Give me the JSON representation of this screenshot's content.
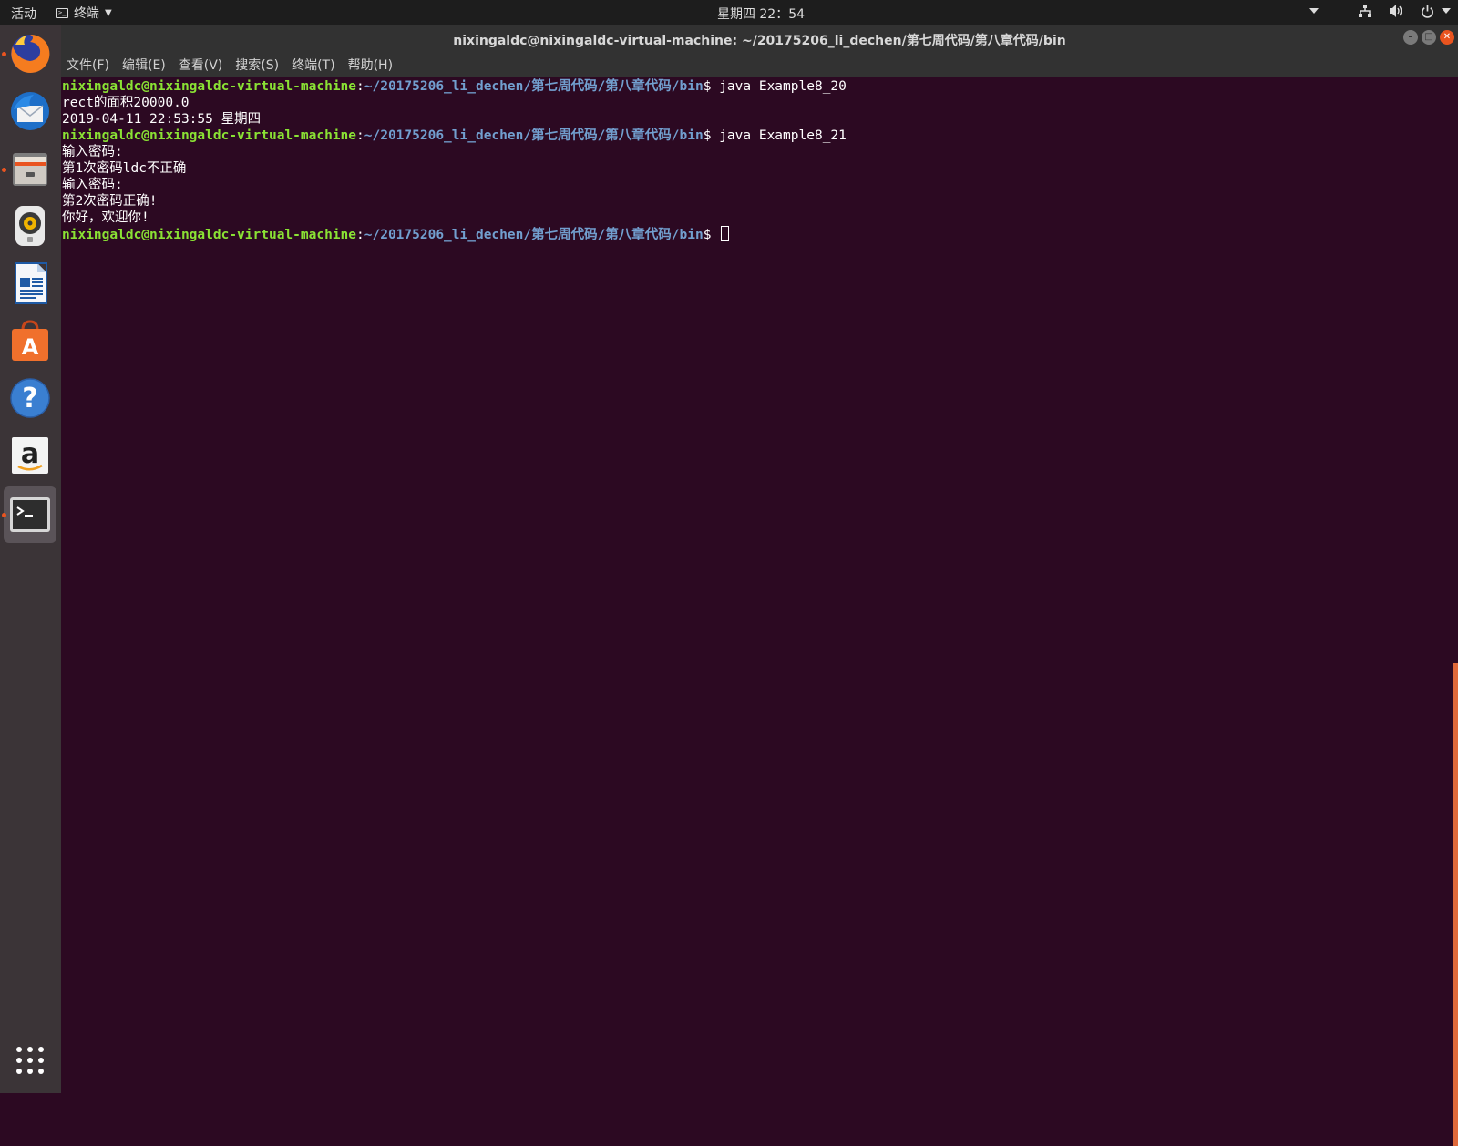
{
  "topbar": {
    "activities": "活动",
    "app_name": "终端",
    "clock": "星期四 22：54",
    "icons": [
      "dropdown-icon",
      "network-icon",
      "volume-icon",
      "power-icon"
    ]
  },
  "dock": {
    "items": [
      {
        "name": "firefox-icon",
        "running": true
      },
      {
        "name": "thunderbird-icon",
        "running": false
      },
      {
        "name": "files-icon",
        "running": true
      },
      {
        "name": "rhythmbox-icon",
        "running": false
      },
      {
        "name": "libreoffice-writer-icon",
        "running": false
      },
      {
        "name": "software-center-icon",
        "running": false
      },
      {
        "name": "help-icon",
        "running": false
      },
      {
        "name": "amazon-icon",
        "running": false
      },
      {
        "name": "terminal-icon",
        "running": true,
        "active": true
      }
    ],
    "show_apps": "app-grid-icon"
  },
  "window": {
    "title": "nixingaldc@nixingaldc-virtual-machine: ~/20175206_li_dechen/第七周代码/第八章代码/bin",
    "menu": [
      "文件(F)",
      "编辑(E)",
      "查看(V)",
      "搜索(S)",
      "终端(T)",
      "帮助(H)"
    ]
  },
  "terminal": {
    "prompt_user": "nixingaldc@nixingaldc-virtual-machine",
    "prompt_sep": ":",
    "prompt_path": "~/20175206_li_dechen/第七周代码/第八章代码/bin",
    "prompt_end": "$ ",
    "cmd1": "java Example8_20",
    "out1": "rect的面积20000.0",
    "out2": "2019-04-11 22:53:55 星期四",
    "cmd2": "java Example8_21",
    "out3": "输入密码:",
    "out4": "第1次密码ldc不正确",
    "out5": "输入密码:",
    "out6": "第2次密码正确!",
    "out7": "你好，欢迎你!"
  },
  "colors": {
    "terminal_bg": "#2c0922",
    "user_green": "#8ae234",
    "path_blue": "#729fcf",
    "ubuntu_orange": "#e95420"
  }
}
